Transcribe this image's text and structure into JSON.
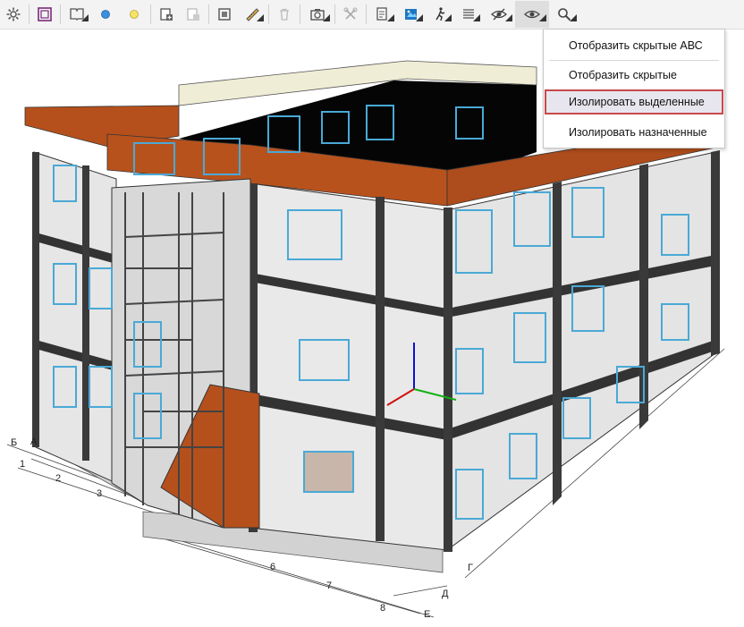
{
  "toolbar": {
    "buttons": [
      {
        "name": "settings-icon",
        "dropdown": false
      },
      {
        "name": "frame-view-icon",
        "dropdown": false
      },
      {
        "name": "book-view-icon",
        "dropdown": true
      },
      {
        "name": "blue-dot-icon",
        "dropdown": false
      },
      {
        "name": "yellow-dot-icon",
        "dropdown": false
      },
      {
        "name": "add-model-icon",
        "dropdown": false
      },
      {
        "name": "copy-model-icon",
        "dropdown": false
      },
      {
        "name": "section-box-icon",
        "dropdown": false
      },
      {
        "name": "measure-icon",
        "dropdown": true
      },
      {
        "name": "trash-icon",
        "dropdown": false
      },
      {
        "name": "camera-icon",
        "dropdown": true
      },
      {
        "name": "tools-icon",
        "dropdown": false
      },
      {
        "name": "report-icon",
        "dropdown": true
      },
      {
        "name": "image-view-icon",
        "dropdown": true
      },
      {
        "name": "walk-icon",
        "dropdown": true
      },
      {
        "name": "list-icon",
        "dropdown": true
      },
      {
        "name": "hide-icon",
        "dropdown": true
      },
      {
        "name": "visibility-icon",
        "dropdown": true
      },
      {
        "name": "search-icon",
        "dropdown": true
      }
    ]
  },
  "visibility_menu": {
    "items": [
      {
        "label": "Отобразить скрытые АВС"
      },
      {
        "label": "Отобразить скрытые"
      },
      {
        "label": "Изолировать выделенные"
      },
      {
        "label": "Изолировать назначенные"
      }
    ],
    "highlighted_index": 2
  },
  "grid_labels": {
    "left": [
      "1",
      "2",
      "3",
      "Б",
      "А"
    ],
    "front": [
      "6",
      "7",
      "8",
      "Д",
      "Е"
    ],
    "right": [
      "Г"
    ]
  },
  "colors": {
    "wall": "#e8e8e8",
    "frame": "#3c3c3c",
    "roof_edge": "#b5501c",
    "window": "#4aa9d6",
    "highlight_border": "#c8474b",
    "highlight_bg": "#e7e6ee"
  }
}
